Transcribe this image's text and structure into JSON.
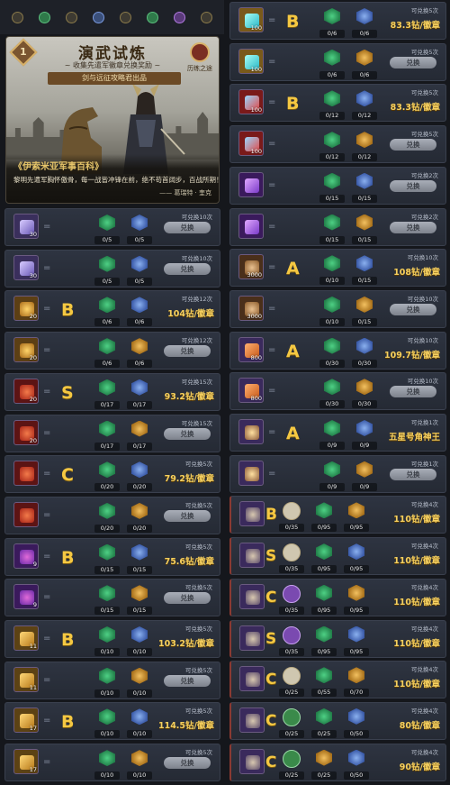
{
  "banner": {
    "number": "1",
    "title": "演武试炼",
    "subtitle": "~ 收集先遣军徽章兑换奖励 ~",
    "ribbon": "剑与远征攻略君出品",
    "road_label": "历练之途",
    "caption_title": "《伊索米亚军事百科》",
    "caption_text": "黎明先遣军胸怀傲骨，每一战皆冲锋在前，绝不苟首阔步，百战所期！",
    "caption_author": "—— 葛瑞特 · 奎克"
  },
  "colors": {
    "panel_bg": "#252a34",
    "grade_gold": "#f5c842",
    "price_gold": "#f5d060",
    "exchange_btn": "#a9aeb8",
    "medal_green": "#22804a",
    "medal_blue": "#3a5aa8",
    "medal_orange": "#a8701a"
  },
  "left_rows": [
    {
      "icon": "purple-crystal-icon",
      "qty": "30",
      "grade": "",
      "medal1_count": "0/5",
      "medal2_count": "0/5",
      "limit": "可兑换10次",
      "button": "兑换",
      "price": ""
    },
    {
      "icon": "purple-crystal-icon",
      "qty": "30",
      "grade": "",
      "medal1_count": "0/5",
      "medal2_count": "0/5",
      "limit": "可兑换10次",
      "button": "兑换",
      "price": ""
    },
    {
      "icon": "gold-chest-icon",
      "qty": "20",
      "grade": "B",
      "medal1_count": "0/6",
      "medal2_count": "0/6",
      "limit": "可兑换12次",
      "button": "",
      "price": "104钻/徽章"
    },
    {
      "icon": "gold-chest-icon",
      "qty": "20",
      "grade": "",
      "medal1_count": "0/6",
      "medal2_count": "0/6",
      "limit": "可兑换12次",
      "button": "兑换",
      "price": ""
    },
    {
      "icon": "red-chest-icon",
      "qty": "20",
      "grade": "S",
      "medal1_count": "0/17",
      "medal2_count": "0/17",
      "limit": "可兑换15次",
      "button": "",
      "price": "93.2钻/徽章"
    },
    {
      "icon": "red-chest-icon",
      "qty": "20",
      "grade": "",
      "medal1_count": "0/17",
      "medal2_count": "0/17",
      "limit": "可兑换15次",
      "button": "兑换",
      "price": ""
    },
    {
      "icon": "red-chest-icon",
      "qty": "",
      "grade": "C",
      "medal1_count": "0/20",
      "medal2_count": "0/20",
      "limit": "可兑换5次",
      "button": "",
      "price": "79.2钻/徽章"
    },
    {
      "icon": "red-chest-icon",
      "qty": "",
      "grade": "",
      "medal1_count": "0/20",
      "medal2_count": "0/20",
      "limit": "可兑换5次",
      "button": "兑换",
      "price": ""
    },
    {
      "icon": "purple-chest-icon",
      "qty": "9",
      "grade": "B",
      "medal1_count": "0/15",
      "medal2_count": "0/15",
      "limit": "可兑换5次",
      "button": "",
      "price": "75.6钻/徽章"
    },
    {
      "icon": "purple-chest-icon",
      "qty": "9",
      "grade": "",
      "medal1_count": "0/15",
      "medal2_count": "0/15",
      "limit": "可兑换5次",
      "button": "兑换",
      "price": ""
    },
    {
      "icon": "gold-treasure-icon",
      "qty": "11",
      "grade": "B",
      "medal1_count": "0/10",
      "medal2_count": "0/10",
      "limit": "可兑换5次",
      "button": "",
      "price": "103.2钻/徽章"
    },
    {
      "icon": "gold-treasure-icon",
      "qty": "11",
      "grade": "",
      "medal1_count": "0/10",
      "medal2_count": "0/10",
      "limit": "可兑换5次",
      "button": "兑换",
      "price": ""
    },
    {
      "icon": "gold-treasure-icon",
      "qty": "17",
      "grade": "B",
      "medal1_count": "0/10",
      "medal2_count": "0/10",
      "limit": "可兑换5次",
      "button": "",
      "price": "114.5钻/徽章"
    },
    {
      "icon": "gold-treasure-icon",
      "qty": "17",
      "grade": "",
      "medal1_count": "0/10",
      "medal2_count": "0/10",
      "limit": "可兑换5次",
      "button": "兑换",
      "price": ""
    }
  ],
  "right_rows": [
    {
      "icon": "cyan-scroll-icon",
      "qty": "100",
      "grade": "B",
      "medal1_count": "0/6",
      "medal2_count": "0/6",
      "limit": "可兑换5次",
      "button": "",
      "price": "83.3钻/徽章"
    },
    {
      "icon": "cyan-scroll-icon",
      "qty": "100",
      "grade": "",
      "medal1_count": "0/6",
      "medal2_count": "0/6",
      "limit": "可兑换5次",
      "button": "兑换",
      "price": ""
    },
    {
      "icon": "red-scroll-icon",
      "qty": "100",
      "grade": "B",
      "medal1_count": "0/12",
      "medal2_count": "0/12",
      "limit": "可兑换5次",
      "button": "",
      "price": "83.3钻/徽章"
    },
    {
      "icon": "red-scroll-icon",
      "qty": "100",
      "grade": "",
      "medal1_count": "0/12",
      "medal2_count": "0/12",
      "limit": "可兑换5次",
      "button": "兑换",
      "price": ""
    },
    {
      "icon": "purple-potion-icon",
      "qty": "",
      "grade": "",
      "medal1_count": "0/15",
      "medal2_count": "0/15",
      "limit": "可兑换2次",
      "button": "兑换",
      "price": ""
    },
    {
      "icon": "purple-potion-icon",
      "qty": "",
      "grade": "",
      "medal1_count": "0/15",
      "medal2_count": "0/15",
      "limit": "可兑换2次",
      "button": "兑换",
      "price": ""
    },
    {
      "icon": "dust-pile-icon",
      "qty": "3000",
      "grade": "A",
      "medal1_count": "0/10",
      "medal2_count": "0/15",
      "limit": "可兑换10次",
      "button": "",
      "price": "108钻/徽章"
    },
    {
      "icon": "dust-pile-icon",
      "qty": "3000",
      "grade": "",
      "medal1_count": "0/10",
      "medal2_count": "0/15",
      "limit": "可兑换10次",
      "button": "兑换",
      "price": ""
    },
    {
      "icon": "orange-key-icon",
      "qty": "800",
      "grade": "A",
      "medal1_count": "0/30",
      "medal2_count": "0/30",
      "limit": "可兑换10次",
      "button": "",
      "price": "109.7钻/徽章"
    },
    {
      "icon": "orange-key-icon",
      "qty": "800",
      "grade": "",
      "medal1_count": "0/30",
      "medal2_count": "0/30",
      "limit": "可兑换10次",
      "button": "兑换",
      "price": ""
    },
    {
      "icon": "star-chest-icon",
      "qty": "",
      "grade": "A",
      "medal1_count": "0/9",
      "medal2_count": "0/9",
      "limit": "可兑换1次",
      "button": "",
      "price": "五星号角神王"
    },
    {
      "icon": "star-chest-icon",
      "qty": "",
      "grade": "",
      "medal1_count": "0/9",
      "medal2_count": "0/9",
      "limit": "可兑换1次",
      "button": "兑换",
      "price": ""
    },
    {
      "icon": "hero-portrait-icon",
      "qty": "",
      "grade": "B",
      "medal0_count": "0/35",
      "medal1_count": "0/95",
      "medal2_count": "0/95",
      "limit": "可兑换4次",
      "button": "",
      "price": "110钻/徽章"
    },
    {
      "icon": "hero-portrait-icon",
      "qty": "",
      "grade": "S",
      "medal0_count": "0/35",
      "medal1_count": "0/95",
      "medal2_count": "0/95",
      "limit": "可兑换4次",
      "button": "",
      "price": "110钻/徽章"
    },
    {
      "icon": "hero-portrait-icon",
      "qty": "",
      "grade": "C",
      "medal0_count": "0/35",
      "medal1_count": "0/95",
      "medal2_count": "0/95",
      "limit": "可兑换4次",
      "button": "",
      "price": "110钻/徽章"
    },
    {
      "icon": "hero-portrait-icon",
      "qty": "",
      "grade": "S",
      "medal0_count": "0/35",
      "medal1_count": "0/95",
      "medal2_count": "0/95",
      "limit": "可兑换4次",
      "button": "",
      "price": "110钻/徽章"
    },
    {
      "icon": "hero-portrait-icon",
      "qty": "",
      "grade": "C",
      "medal0_count": "0/25",
      "medal1_count": "0/55",
      "medal2_count": "0/70",
      "limit": "可兑换4次",
      "button": "",
      "price": "110钻/徽章"
    },
    {
      "icon": "hero-portrait-icon",
      "qty": "",
      "grade": "C",
      "medal0_count": "0/25",
      "medal1_count": "0/25",
      "medal2_count": "0/50",
      "limit": "可兑换4次",
      "button": "",
      "price": "80钻/徽章"
    },
    {
      "icon": "hero-portrait-icon",
      "qty": "",
      "grade": "C",
      "medal0_count": "0/25",
      "medal1_count": "0/25",
      "medal2_count": "0/50",
      "limit": "可兑换4次",
      "button": "",
      "price": "90钻/徽章"
    }
  ]
}
